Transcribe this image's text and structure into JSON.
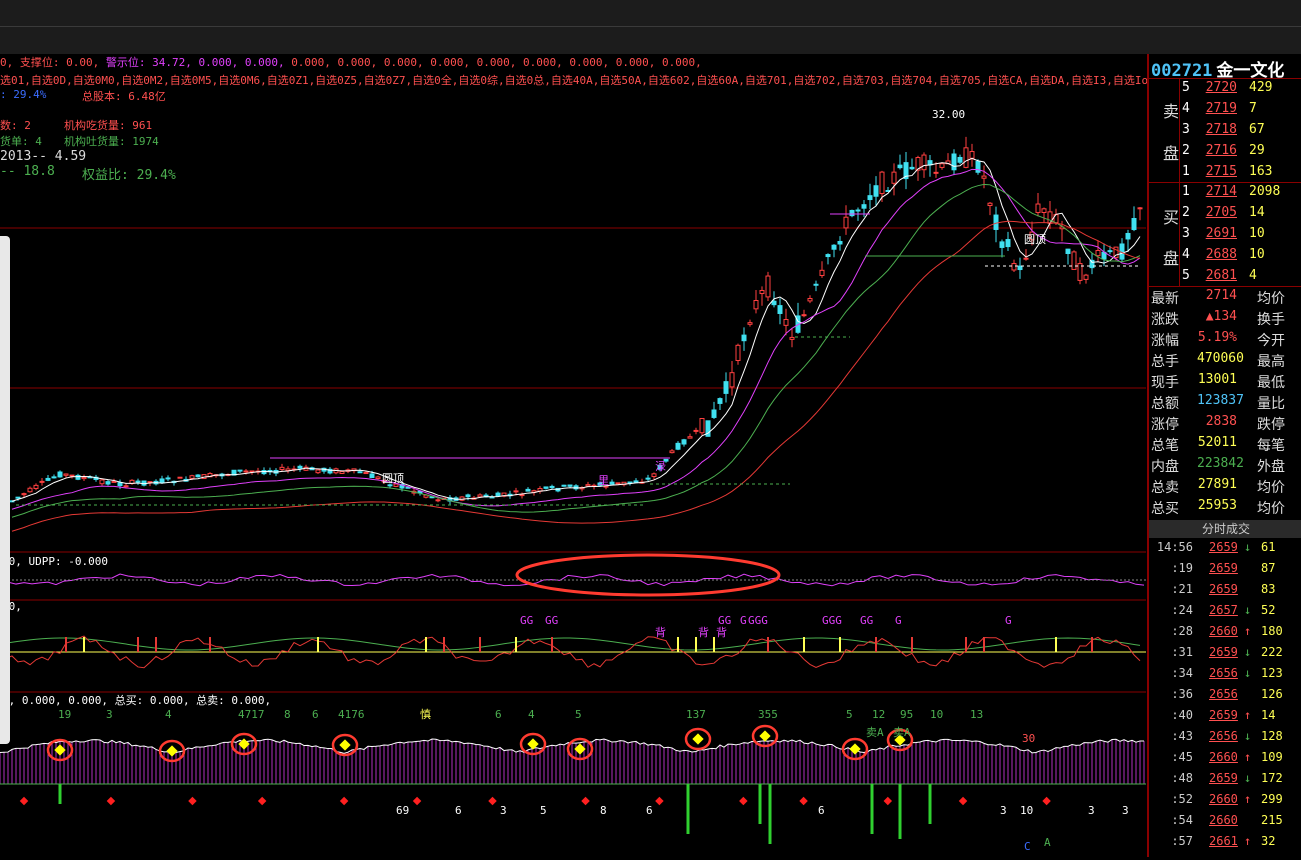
{
  "stock": {
    "code": "002721",
    "name": "金一文化"
  },
  "indicator_line1": {
    "parts": [
      {
        "text": "0, 支撑位: 0.00, ",
        "color": "#ff5050"
      },
      {
        "text": "警示位: ",
        "color": "#e040fb"
      },
      {
        "text": "34.72, 0.000, 0.000, ",
        "color": "#e040fb"
      },
      {
        "text": "0.000, 0.000, 0.000, 0.000, 0.000, 0.000, 0.000, 0.000, 0.000,",
        "color": "#ff5050"
      }
    ]
  },
  "watchlist_line": "选01,自选0D,自选0M0,自选0M2,自选0M5,自选0M6,自选0Z1,自选0Z5,自选0Z7,自选0全,自选0综,自选0总,自选40A,自选50A,自选602,自选60A,自选701,自选702,自选703,自选704,自选705,自选CA,自选DA,自选I3,自选Io",
  "info": {
    "r1a": ": 29.4%",
    "r1b": "总股本: 6.48亿",
    "r2a": "数: 2",
    "r2b": "机构吃货量: 961",
    "r3a": "货单: 4",
    "r3b": "机构吐货量: 1974",
    "r4": "2013-- 4.59",
    "r5a": "-- 18.8",
    "r5b": "权益比: 29.4%"
  },
  "main_chart_labels": {
    "high_price": "32.00",
    "tag1": "圆顶",
    "tag2": "圆顶",
    "tag3": "圆顶",
    "tag4": "渌",
    "tag5": "里"
  },
  "panel2_label": "00, UDPP: -0.000",
  "panel3_label": "00,",
  "panel3_marks": [
    "GG",
    "GG",
    "GGG",
    "GG",
    "GGG",
    "GG",
    "G",
    "G",
    "G",
    "背",
    "背",
    "背"
  ],
  "panel4_label": "0, 0.000, 0.000, 总买: 0.000, 总卖: 0.000,",
  "panel4_top_numbers": [
    "19",
    "3",
    "4",
    "4717",
    "8",
    "6",
    "4176",
    "慎",
    "6",
    "4",
    "5",
    "137",
    "355",
    "5",
    "12",
    "95",
    "10",
    "13"
  ],
  "panel4_bottom_numbers": [
    "69",
    "6",
    "3",
    "5",
    "8",
    "6",
    "6",
    "3",
    "10",
    "3",
    "3"
  ],
  "panel4_tags": [
    "卖A",
    "卖A",
    "30",
    "C",
    "A"
  ],
  "asks": [
    {
      "level": "5",
      "price": "2720",
      "vol": "429"
    },
    {
      "level": "4",
      "price": "2719",
      "vol": "7"
    },
    {
      "level": "3",
      "price": "2718",
      "vol": "67"
    },
    {
      "level": "2",
      "price": "2716",
      "vol": "29"
    },
    {
      "level": "1",
      "price": "2715",
      "vol": "163"
    }
  ],
  "bids": [
    {
      "level": "1",
      "price": "2714",
      "vol": "2098"
    },
    {
      "level": "2",
      "price": "2705",
      "vol": "14"
    },
    {
      "level": "3",
      "price": "2691",
      "vol": "10"
    },
    {
      "level": "4",
      "price": "2688",
      "vol": "10"
    },
    {
      "level": "5",
      "price": "2681",
      "vol": "4"
    }
  ],
  "sell_label": {
    "a": "卖",
    "b": "盘"
  },
  "buy_label": {
    "a": "买",
    "b": "盘"
  },
  "stats": [
    {
      "k1": "最新",
      "v1": "2714",
      "c1": "#ff5050",
      "k2": "均价"
    },
    {
      "k1": "涨跌",
      "v1": "▲134",
      "c1": "#ff5050",
      "k2": "换手"
    },
    {
      "k1": "涨幅",
      "v1": "5.19%",
      "c1": "#ff5050",
      "k2": "今开"
    },
    {
      "k1": "总手",
      "v1": "470060",
      "c1": "#ffff55",
      "k2": "最高"
    },
    {
      "k1": "现手",
      "v1": "13001",
      "c1": "#ffff55",
      "k2": "最低"
    },
    {
      "k1": "总额",
      "v1": "123837",
      "c1": "#4fc3f7",
      "k2": "量比"
    },
    {
      "k1": "涨停",
      "v1": "2838",
      "c1": "#ff5050",
      "k2": "跌停"
    },
    {
      "k1": "总笔",
      "v1": "52011",
      "c1": "#ffff55",
      "k2": "每笔"
    },
    {
      "k1": "内盘",
      "v1": "223842",
      "c1": "#4caf50",
      "k2": "外盘"
    },
    {
      "k1": "总卖",
      "v1": "27891",
      "c1": "#ffff55",
      "k2": "均价"
    },
    {
      "k1": "总买",
      "v1": "25953",
      "c1": "#ffff55",
      "k2": "均价"
    }
  ],
  "ticks_title": "分时成交",
  "ticks": [
    {
      "time": "14:56",
      "price": "2659",
      "arrow": "↓",
      "ac": "#4caf50",
      "vol": "61"
    },
    {
      "time": ":19",
      "price": "2659",
      "arrow": "",
      "ac": "#ccc",
      "vol": "87"
    },
    {
      "time": ":21",
      "price": "2659",
      "arrow": "",
      "ac": "#ccc",
      "vol": "83"
    },
    {
      "time": ":24",
      "price": "2657",
      "arrow": "↓",
      "ac": "#4caf50",
      "vol": "52"
    },
    {
      "time": ":28",
      "price": "2660",
      "arrow": "↑",
      "ac": "#ff5050",
      "vol": "180"
    },
    {
      "time": ":31",
      "price": "2659",
      "arrow": "↓",
      "ac": "#4caf50",
      "vol": "222"
    },
    {
      "time": ":34",
      "price": "2656",
      "arrow": "↓",
      "ac": "#4caf50",
      "vol": "123"
    },
    {
      "time": ":36",
      "price": "2656",
      "arrow": "",
      "ac": "#ccc",
      "vol": "126"
    },
    {
      "time": ":40",
      "price": "2659",
      "arrow": "↑",
      "ac": "#ff5050",
      "vol": "14"
    },
    {
      "time": ":43",
      "price": "2656",
      "arrow": "↓",
      "ac": "#4caf50",
      "vol": "128"
    },
    {
      "time": ":45",
      "price": "2660",
      "arrow": "↑",
      "ac": "#ff5050",
      "vol": "109"
    },
    {
      "time": ":48",
      "price": "2659",
      "arrow": "↓",
      "ac": "#4caf50",
      "vol": "172"
    },
    {
      "time": ":52",
      "price": "2660",
      "arrow": "↑",
      "ac": "#ff5050",
      "vol": "299"
    },
    {
      "time": ":54",
      "price": "2660",
      "arrow": "",
      "ac": "#ccc",
      "vol": "215"
    },
    {
      "time": ":57",
      "price": "2661",
      "arrow": "↑",
      "ac": "#ff5050",
      "vol": "32"
    }
  ],
  "colors": {
    "up": "#ff4040",
    "down": "#40e0f0",
    "ma_white": "#ffffff",
    "ma_magenta": "#e040fb",
    "ma_green": "#4caf50",
    "ma_red": "#e53935",
    "border": "#8a0000"
  }
}
